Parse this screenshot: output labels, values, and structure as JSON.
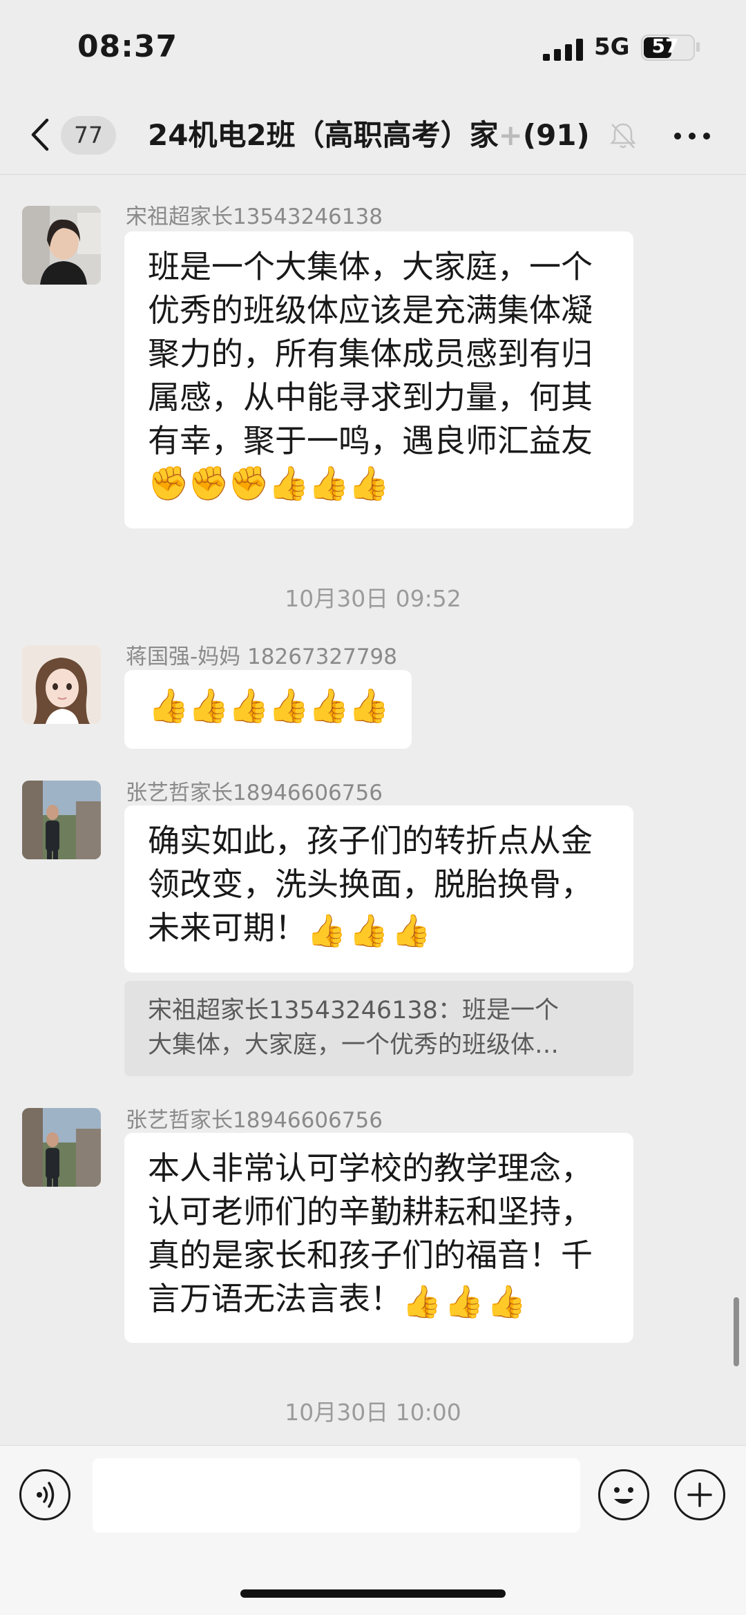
{
  "status_bar": {
    "time": "08:37",
    "network": "5G",
    "battery": "57",
    "battery_level": 0.57
  },
  "nav": {
    "unread_count": "77",
    "title": "24机电2班（高职高考）家",
    "title_fade": "+",
    "member_count": "(91)"
  },
  "messages": [
    {
      "sender": "宋祖超家长13543246138",
      "text": "班是一个大集体，大家庭，一个\n优秀的班级体应该是充满集体凝\n聚力的，所有集体成员感到有归\n属感，从中能寻求到力量，何其\n有幸，聚于一鸣，遇良师汇益友",
      "emojis": [
        "✊",
        "✊",
        "✊",
        "👍",
        "👍",
        "👍"
      ]
    },
    {
      "sender": "蒋国强-妈妈 18267327798",
      "emojis": [
        "👍",
        "👍",
        "👍",
        "👍",
        "👍",
        "👍"
      ]
    },
    {
      "sender": "张艺哲家长18946606756",
      "text": "确实如此，孩子们的转折点从金\n领改变，洗头换面，脱胎换骨，\n未来可期！",
      "emojis": [
        "👍",
        "👍",
        "👍"
      ],
      "quote": {
        "line1": "宋祖超家长13543246138：班是一个",
        "line2": "大集体，大家庭，一个优秀的班级体…"
      }
    },
    {
      "sender": "张艺哲家长18946606756",
      "text": "本人非常认可学校的教学理念，\n认可老师们的辛勤耕耘和坚持，\n真的是家长和孩子们的福音！千\n言万语无法言表！",
      "emojis": [
        "👍",
        "👍",
        "👍"
      ]
    }
  ],
  "timestamps": [
    "10月30日 09:52",
    "10月30日 10:00"
  ],
  "input": {
    "placeholder": ""
  },
  "icons": [
    "back-icon",
    "mute-icon",
    "more-icon",
    "voice-icon",
    "emoji-icon",
    "plus-icon"
  ]
}
